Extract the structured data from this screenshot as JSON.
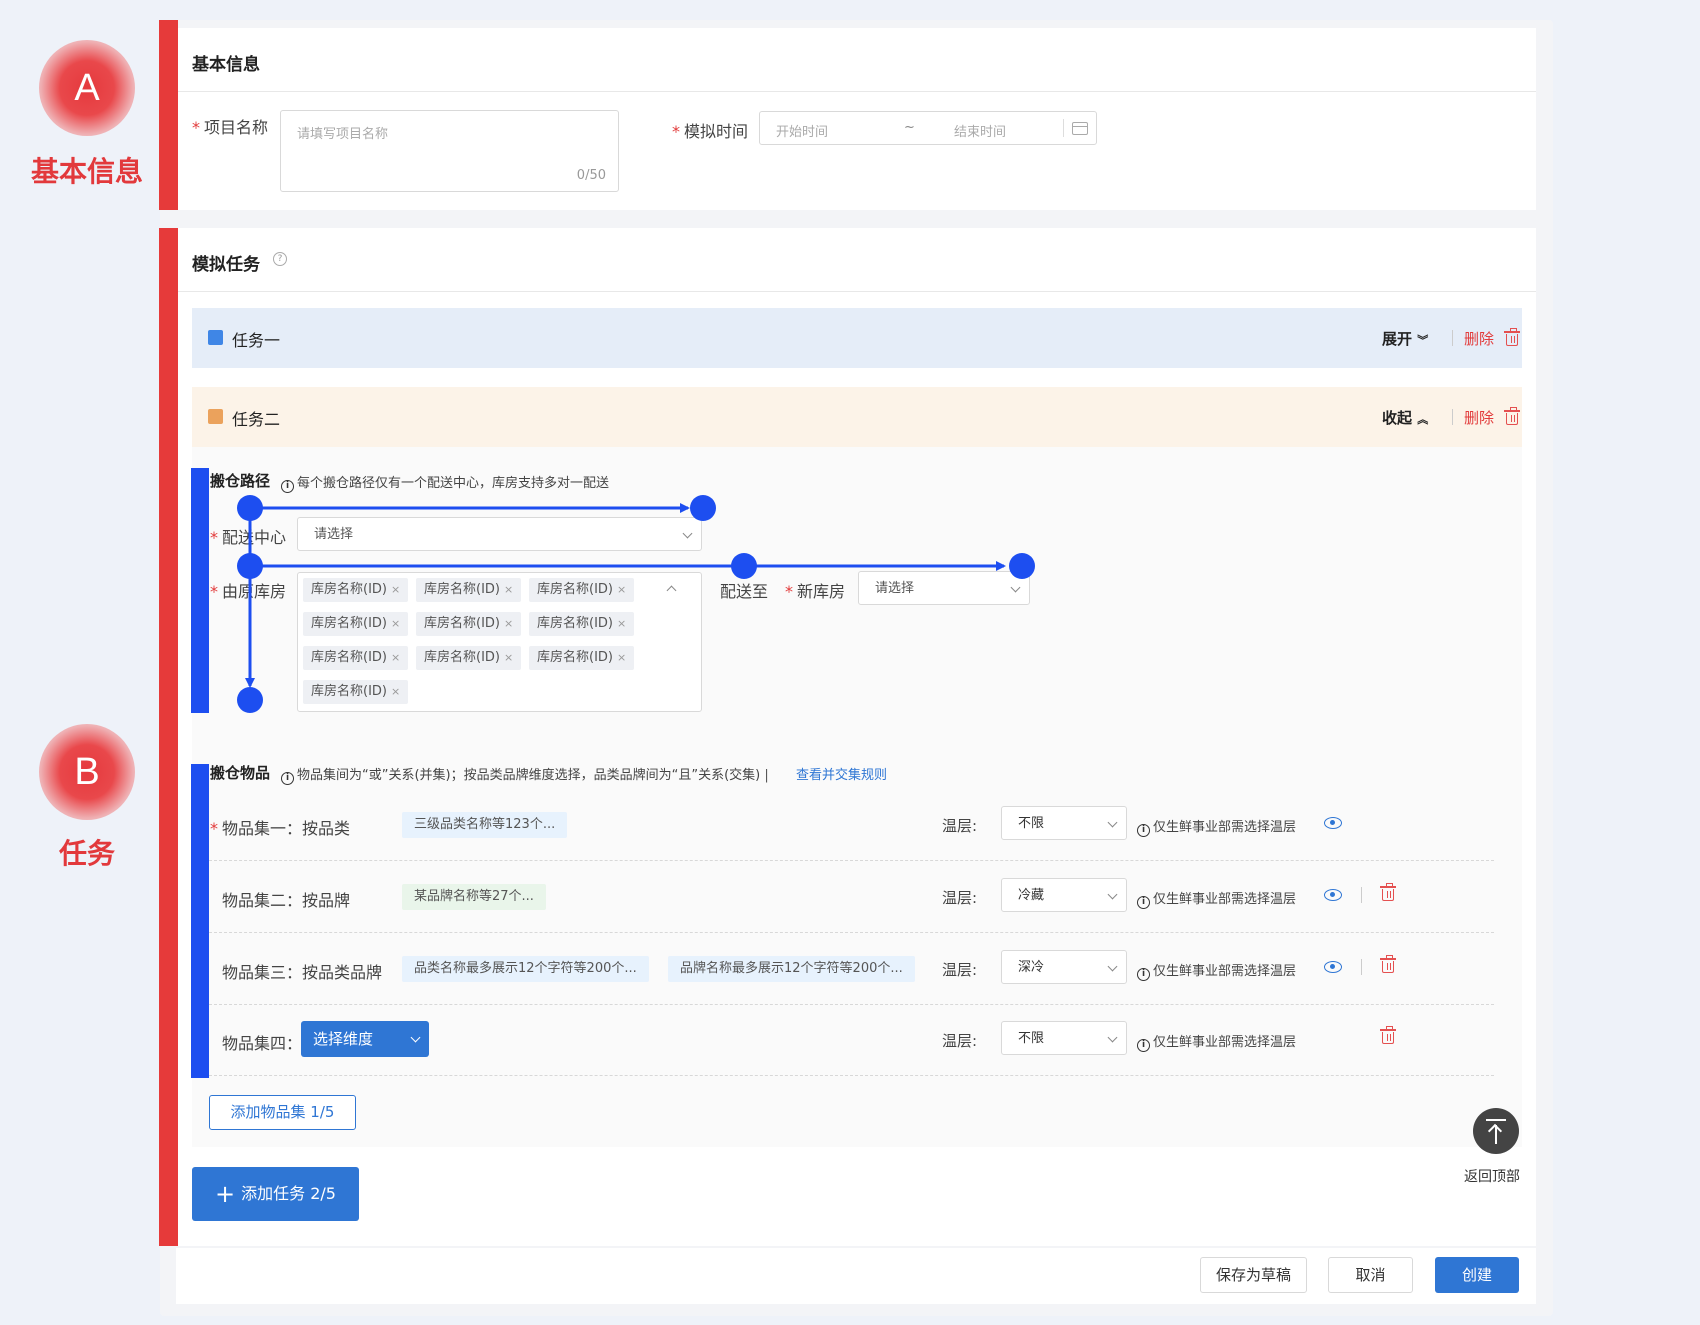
{
  "annotations": {
    "a": {
      "letter": "A",
      "label": "基本信息"
    },
    "b": {
      "letter": "B",
      "label": "任务"
    }
  },
  "basic": {
    "title": "基本信息",
    "project_name_label": "项目名称",
    "project_name_placeholder": "请填写项目名称",
    "project_name_counter": "0/50",
    "sim_time_label": "模拟时间",
    "start_placeholder": "开始时间",
    "range_sep": "~",
    "end_placeholder": "结束时间"
  },
  "tasks_section": {
    "title": "模拟任务",
    "task1": {
      "title": "任务一",
      "toggle": "展开",
      "delete": "删除"
    },
    "task2": {
      "title": "任务二",
      "toggle": "收起",
      "delete": "删除"
    }
  },
  "route": {
    "title": "搬仓路径",
    "hint": "每个搬仓路径仅有一个配送中心，库房支持多对一配送",
    "center_label": "配送中心",
    "center_placeholder": "请选择",
    "source_label": "由原库房",
    "source_tags": [
      "库房名称(ID)",
      "库房名称(ID)",
      "库房名称(ID)",
      "库房名称(ID)",
      "库房名称(ID)",
      "库房名称(ID)",
      "库房名称(ID)",
      "库房名称(ID)",
      "库房名称(ID)",
      "库房名称(ID)"
    ],
    "deliver_to": "配送至",
    "new_wh_label": "新库房",
    "new_wh_placeholder": "请选择"
  },
  "goods": {
    "title": "搬仓物品",
    "hint": "物品集间为“或”关系(并集)；按品类品牌维度选择，品类品牌间为“且”关系(交集)",
    "hint_sep": "|",
    "rule_link": "查看并交集规则",
    "temp_label": "温层:",
    "temp_hint": "仅生鲜事业部需选择温层",
    "sets": [
      {
        "label": "物品集一：按品类",
        "chips": [
          "三级品类名称等123个..."
        ],
        "temp": "不限"
      },
      {
        "label": "物品集二：按品牌",
        "chips": [
          "某品牌名称等27个..."
        ],
        "temp": "冷藏"
      },
      {
        "label": "物品集三：按品类品牌",
        "chips": [
          "品类名称最多展示12个字符等200个...",
          "品牌名称最多展示12个字符等200个..."
        ],
        "temp": "深冷"
      },
      {
        "label": "物品集四：",
        "dimension_button": "选择维度",
        "temp": "不限"
      }
    ],
    "add_set_button": "添加物品集 1/5"
  },
  "add_task_button": "添加任务 2/5",
  "back_to_top": "返回顶部",
  "footer": {
    "save_draft": "保存为草稿",
    "cancel": "取消",
    "create": "创建"
  },
  "colors": {
    "accent_red": "#e63a3a",
    "accent_blue": "#1d4ef0",
    "primary": "#2f76d4"
  }
}
